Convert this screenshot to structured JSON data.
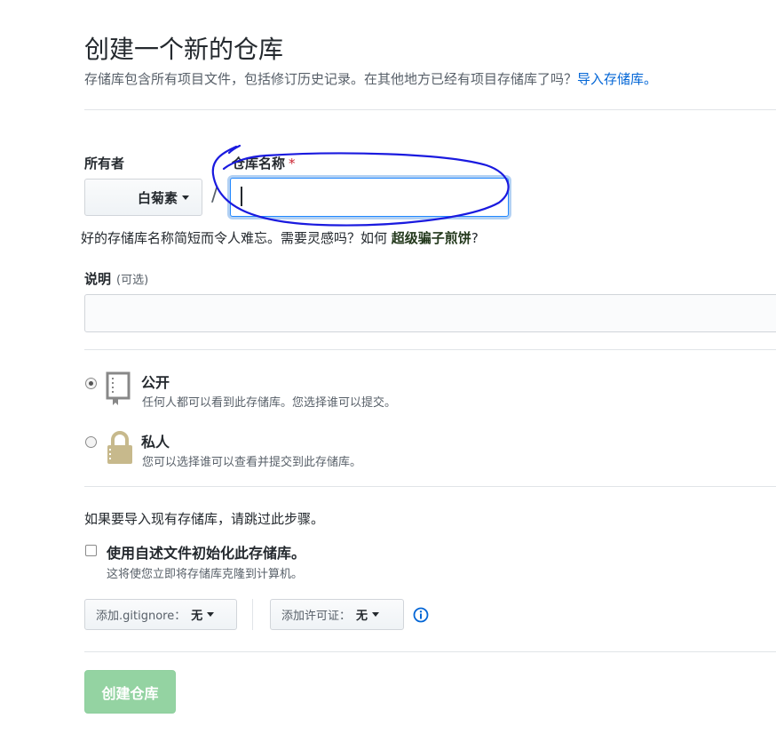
{
  "header": {
    "title": "创建一个新的仓库",
    "subtitle": "存储库包含所有项目文件，包括修订历史记录。在其他地方已经有项目存储库了吗？",
    "import_link": "导入存储库。"
  },
  "owner": {
    "label": "所有者",
    "value": "白菊素"
  },
  "repo_name": {
    "label": "仓库名称",
    "required_mark": "*",
    "value": "",
    "separator": "/"
  },
  "hint": {
    "text": "好的存储库名称简短而令人难忘。需要灵感吗？如何",
    "suggestion": "超级骗子煎饼",
    "end": "?"
  },
  "description": {
    "label": "说明",
    "optional": "(可选)",
    "value": ""
  },
  "visibility": {
    "public": {
      "title": "公开",
      "desc": "任何人都可以看到此存储库。您选择谁可以提交。",
      "selected": true
    },
    "private": {
      "title": "私人",
      "desc": "您可以选择谁可以查看并提交到此存储库。",
      "selected": false
    }
  },
  "init": {
    "skip_text": "如果要导入现有存储库，请跳过此步骤。",
    "readme_label": "使用自述文件初始化此存储库。",
    "readme_desc": "这将使您立即将存储库克隆到计算机。",
    "readme_checked": false
  },
  "gitignore": {
    "label": "添加.gitignore：",
    "value": "无"
  },
  "license": {
    "label": "添加许可证：",
    "value": "无"
  },
  "submit": {
    "label": "创建仓库"
  },
  "icons": {
    "public": "repo-book-icon",
    "private": "lock-icon",
    "info": "info-icon"
  },
  "colors": {
    "link": "#0366d6",
    "create_button": "#94d3a2",
    "annotation": "#1a1adf"
  }
}
